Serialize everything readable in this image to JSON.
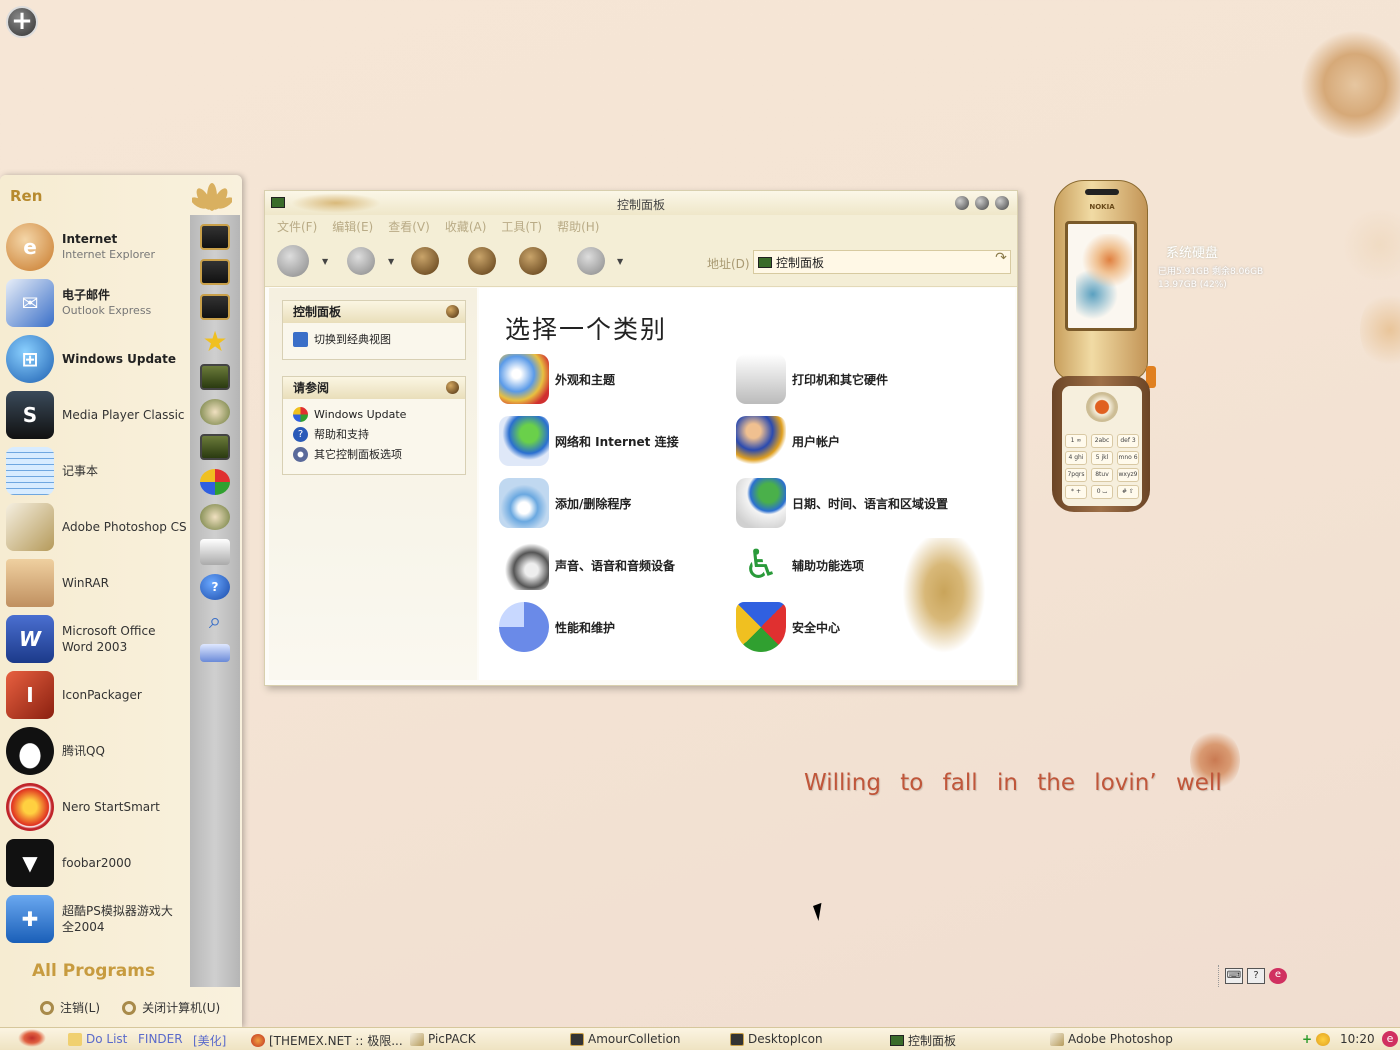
{
  "desktop": {
    "slogan": "Willing  to  fall  in  the  lovin’ well",
    "disk_widget": {
      "title": "系统硬盘",
      "line1": "已用5.91GB  剩余8.06GB",
      "line2": "13.97GB  (42%)"
    },
    "phone": {
      "brand": "NOKIA",
      "keys": [
        "1 ∞",
        "2abc",
        "def 3",
        "4 ghi",
        "5 jkl",
        "mno 6",
        "7pqrs",
        "8tuv",
        "wxyz9",
        "* +",
        "0 ⌴",
        "# ⇧"
      ]
    }
  },
  "start_menu": {
    "user_name": "Ren",
    "items": [
      {
        "label": "Internet",
        "sub": "Internet Explorer",
        "bold": true,
        "icon": "internet-explorer-icon",
        "color": "#c8792a"
      },
      {
        "label": "电子邮件",
        "sub": "Outlook Express",
        "bold": true,
        "icon": "outlook-express-icon",
        "color": "#3a6fc8"
      },
      {
        "label": "Windows Update",
        "sub": "",
        "bold": true,
        "icon": "windows-update-icon",
        "color": "#2f7fd0"
      },
      {
        "label": "Media Player Classic",
        "sub": "",
        "bold": false,
        "icon": "media-player-classic-icon",
        "color": "#1b2a3a"
      },
      {
        "label": "记事本",
        "sub": "",
        "bold": false,
        "icon": "notepad-icon",
        "color": "#6fa7e0"
      },
      {
        "label": "Adobe Photoshop CS",
        "sub": "",
        "bold": false,
        "icon": "photoshop-feather-icon",
        "color": "#b59a5a"
      },
      {
        "label": "WinRAR",
        "sub": "",
        "bold": false,
        "icon": "winrar-box-icon",
        "color": "#d8b07a"
      },
      {
        "label": "Microsoft Office Word 2003",
        "sub": "",
        "bold": false,
        "icon": "word-icon",
        "color": "#2c4fa8"
      },
      {
        "label": "IconPackager",
        "sub": "",
        "bold": false,
        "icon": "iconpackager-icon",
        "color": "#b23a20"
      },
      {
        "label": "腾讯QQ",
        "sub": "",
        "bold": false,
        "icon": "qq-penguin-icon",
        "color": "#222222"
      },
      {
        "label": "Nero StartSmart",
        "sub": "",
        "bold": false,
        "icon": "nero-flame-icon",
        "color": "#c0242a"
      },
      {
        "label": "foobar2000",
        "sub": "",
        "bold": false,
        "icon": "foobar-fox-icon",
        "color": "#111111"
      },
      {
        "label": "超酷PS模拟器游戏大全2004",
        "sub": "",
        "bold": false,
        "icon": "gamepad-icon",
        "color": "#3a7fd8"
      }
    ],
    "all_programs": "All Programs",
    "logoff": "注销(L)",
    "shutdown": "关闭计算机(U)",
    "right_icons": [
      "my-documents-icon",
      "my-pictures-icon",
      "my-music-icon",
      "favorites-star-icon",
      "my-computer-icon",
      "network-icon",
      "control-panel-icon",
      "set-program-access-icon",
      "connect-to-icon",
      "printers-icon",
      "help-icon",
      "search-icon",
      "run-icon"
    ]
  },
  "control_panel": {
    "title": "控制面板",
    "menu": [
      "文件(F)",
      "编辑(E)",
      "查看(V)",
      "收藏(A)",
      "工具(T)",
      "帮助(H)"
    ],
    "address_label": "地址(D)",
    "address_value": "控制面板",
    "left_box1": {
      "title": "控制面板",
      "items": [
        "切换到经典视图"
      ]
    },
    "left_box2": {
      "title": "请参阅",
      "items": [
        "Windows Update",
        "帮助和支持",
        "其它控制面板选项"
      ]
    },
    "heading": "选择一个类别",
    "categories": [
      {
        "label": "外观和主题",
        "icon": "appearance-themes-icon"
      },
      {
        "label": "打印机和其它硬件",
        "icon": "printers-hardware-icon"
      },
      {
        "label": "网络和 Internet 连接",
        "icon": "network-internet-icon"
      },
      {
        "label": "用户帐户",
        "icon": "user-accounts-icon"
      },
      {
        "label": "添加/删除程序",
        "icon": "add-remove-programs-icon"
      },
      {
        "label": "日期、时间、语言和区域设置",
        "icon": "date-time-region-icon"
      },
      {
        "label": "声音、语音和音频设备",
        "icon": "sounds-audio-icon"
      },
      {
        "label": "辅助功能选项",
        "icon": "accessibility-icon"
      },
      {
        "label": "性能和维护",
        "icon": "performance-maintenance-icon"
      },
      {
        "label": "安全中心",
        "icon": "security-center-icon"
      }
    ]
  },
  "taskbar": {
    "quicklaunch": [
      "Do List",
      "FINDER",
      "[美化]"
    ],
    "tasks": [
      "[THEMEX.NET :: 极限...",
      "PicPACK",
      "AmourColletion",
      "DesktopIcon",
      "控制面板",
      "Adobe Photoshop"
    ],
    "clock": "10:20"
  },
  "colors": {
    "accent": "#c79b3f",
    "slogan": "#c0563a",
    "window_bg": "#fdfcf8"
  }
}
